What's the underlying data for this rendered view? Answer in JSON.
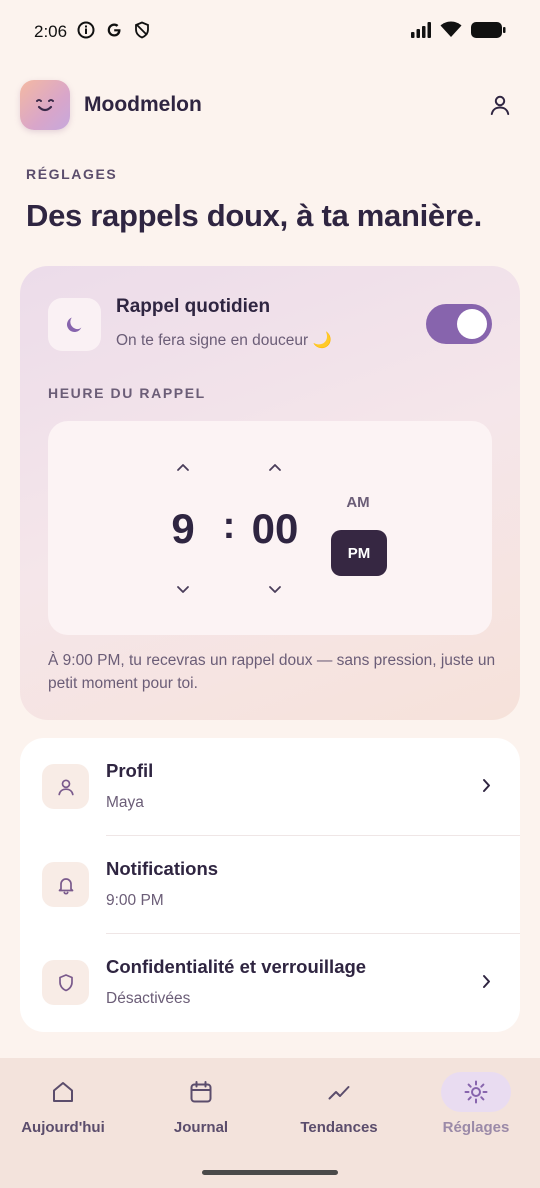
{
  "status_bar": {
    "time": "2:06"
  },
  "header": {
    "app_name": "Moodmelon"
  },
  "page": {
    "eyebrow": "RÉGLAGES",
    "title": "Des rappels doux, à ta manière."
  },
  "reminder": {
    "title": "Rappel quotidien",
    "subtitle": "On te fera signe en douceur 🌙",
    "enabled": true,
    "time_label": "HEURE DU RAPPEL",
    "hour": "9",
    "separator": ":",
    "minute": "00",
    "am_label": "AM",
    "pm_label": "PM",
    "selected_period": "PM",
    "note": "À 9:00 PM, tu recevras un rappel doux — sans pression, juste un petit moment pour toi."
  },
  "settings": {
    "items": [
      {
        "title": "Profil",
        "subtitle": "Maya",
        "icon": "person-icon"
      },
      {
        "title": "Notifications",
        "subtitle": "9:00 PM",
        "icon": "bell-icon"
      },
      {
        "title": "Confidentialité et verrouillage",
        "subtitle": "Désactivées",
        "icon": "shield-icon"
      }
    ]
  },
  "nav": {
    "items": [
      {
        "label": "Aujourd'hui",
        "icon": "home-icon"
      },
      {
        "label": "Journal",
        "icon": "calendar-icon"
      },
      {
        "label": "Tendances",
        "icon": "trend-icon"
      },
      {
        "label": "Réglages",
        "icon": "sun-settings-icon",
        "active": true
      }
    ]
  },
  "colors": {
    "accent": "#8764ad",
    "dark": "#362742",
    "background": "#fcf3ee"
  }
}
